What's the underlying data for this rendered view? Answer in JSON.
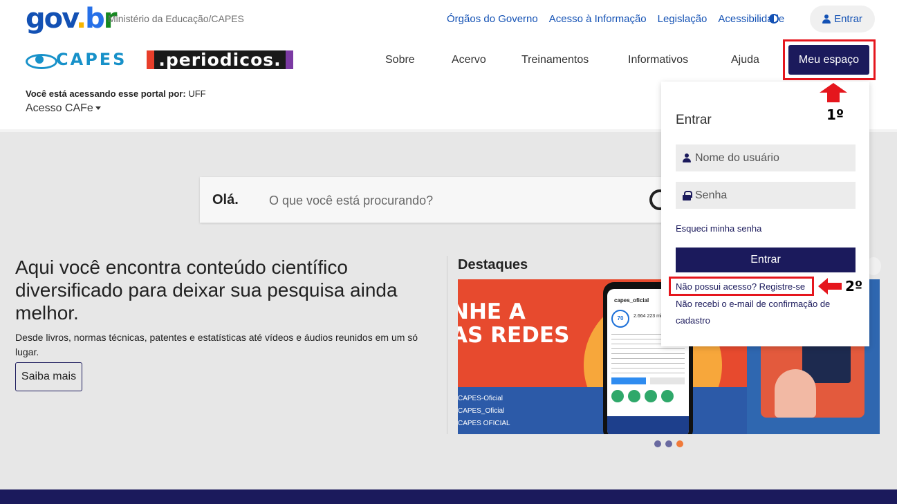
{
  "govbar": {
    "logo": {
      "part1": "gov",
      "part2": ".",
      "part3": "b",
      "part4": "r"
    },
    "ministry": "Ministério da Educação/CAPES",
    "links": [
      "Órgãos do Governo",
      "Acesso à Informação",
      "Legislação",
      "Acessibilidade"
    ],
    "entrar_label": "Entrar"
  },
  "navbar": {
    "capes_text": "CAPES",
    "periodicos_text": ".periodicos.",
    "items": [
      "Sobre",
      "Acervo",
      "Treinamentos",
      "Informativos",
      "Ajuda"
    ],
    "meu_espaco_label": "Meu espaço"
  },
  "access": {
    "prefix": "Você está acessando esse portal por:",
    "institution": "UFF",
    "cafe_label": "Acesso CAFe"
  },
  "search": {
    "greeting": "Olá.",
    "placeholder": "O que você está procurando?"
  },
  "hero": {
    "title": "Aqui você encontra conteúdo científico diversificado para deixar sua pesquisa ainda melhor.",
    "subtitle": "Desde livros, normas técnicas, patentes e estatísticas até vídeos e áudios reunidos em um só lugar.",
    "button_label": "Saiba mais"
  },
  "destaques": {
    "title": "Destaques",
    "slide1": {
      "text_line1": "NHE A",
      "text_line2": "AS REDES",
      "handles": [
        "CAPES-Oficial",
        "CAPES_Oficial",
        "CAPES OFICIAL"
      ],
      "phone_account": "capes_oficial",
      "phone_badge": "70",
      "phone_stats": "2.664  223 mil"
    },
    "dots": [
      false,
      false,
      true
    ]
  },
  "login_panel": {
    "title": "Entrar",
    "username_placeholder": "Nome do usuário",
    "password_placeholder": "Senha",
    "forgot": "Esqueci minha senha",
    "submit_label": "Entrar",
    "register": "Não possui acesso? Registre-se",
    "no_email": "Não recebi o e-mail de confirmação de cadastro"
  },
  "annotations": {
    "step1": "1º",
    "step2": "2º"
  },
  "colors": {
    "navy": "#1b1a5c",
    "gov_blue": "#1351b4",
    "capes_blue": "#1791c9",
    "annotation_red": "#e5161d",
    "accent_orange": "#f07a3a"
  }
}
